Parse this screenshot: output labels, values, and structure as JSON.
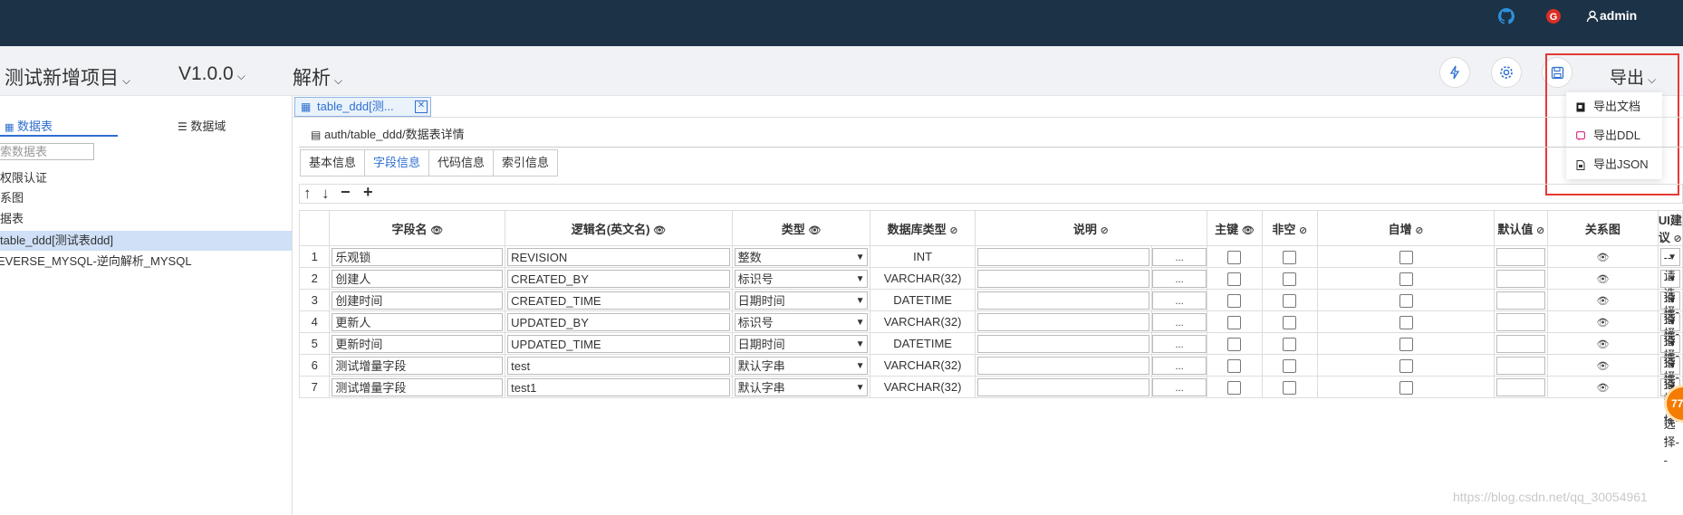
{
  "topbar": {
    "user": "admin",
    "icons": [
      "github-icon",
      "g-icon",
      "user-icon"
    ]
  },
  "header": {
    "project": "测试新增项目",
    "version": "V1.0.0",
    "parse": "解析",
    "export": "导出",
    "icons": [
      "flash-icon",
      "gear-icon",
      "save-icon"
    ]
  },
  "export_menu": {
    "items": [
      "导出文档",
      "导出DDL",
      "导出JSON"
    ]
  },
  "sidebar": {
    "tabs": [
      "数据表",
      "数据域"
    ],
    "search_placeholder": "索数据表",
    "tree": [
      "权限认证",
      "系图",
      "据表",
      "table_ddd[测试表ddd]",
      "EVERSE_MYSQL-逆向解析_MYSQL"
    ]
  },
  "content": {
    "tab_label": "table_ddd[测...",
    "breadcrumb": "auth/table_ddd/数据表详情",
    "subtabs": [
      "基本信息",
      "字段信息",
      "代码信息",
      "索引信息"
    ],
    "toolbar": [
      "↑",
      "↓",
      "−",
      "+"
    ],
    "columns": [
      "字段名",
      "逻辑名(英文名)",
      "类型",
      "数据库类型",
      "说明",
      "主键",
      "非空",
      "自增",
      "默认值",
      "关系图",
      "UI建议"
    ],
    "rows": [
      {
        "idx": "1",
        "name": "乐观锁",
        "logic": "REVISION",
        "type": "整数",
        "dbtype": "INT"
      },
      {
        "idx": "2",
        "name": "创建人",
        "logic": "CREATED_BY",
        "type": "标识号",
        "dbtype": "VARCHAR(32)"
      },
      {
        "idx": "3",
        "name": "创建时间",
        "logic": "CREATED_TIME",
        "type": "日期时间",
        "dbtype": "DATETIME"
      },
      {
        "idx": "4",
        "name": "更新人",
        "logic": "UPDATED_BY",
        "type": "标识号",
        "dbtype": "VARCHAR(32)"
      },
      {
        "idx": "5",
        "name": "更新时间",
        "logic": "UPDATED_TIME",
        "type": "日期时间",
        "dbtype": "DATETIME"
      },
      {
        "idx": "6",
        "name": "测试增量字段",
        "logic": "test",
        "type": "默认字串",
        "dbtype": "VARCHAR(32)"
      },
      {
        "idx": "7",
        "name": "测试增量字段",
        "logic": "test1",
        "type": "默认字串",
        "dbtype": "VARCHAR(32)"
      }
    ],
    "ui_select": "--请选择--",
    "ellipsis": "..."
  },
  "badge": "77",
  "watermark": "https://blog.csdn.net/qq_30054961",
  "colors": {
    "topbar": "#1c3247",
    "accent": "#2f6fd0",
    "highlight_box": "#e53935"
  }
}
